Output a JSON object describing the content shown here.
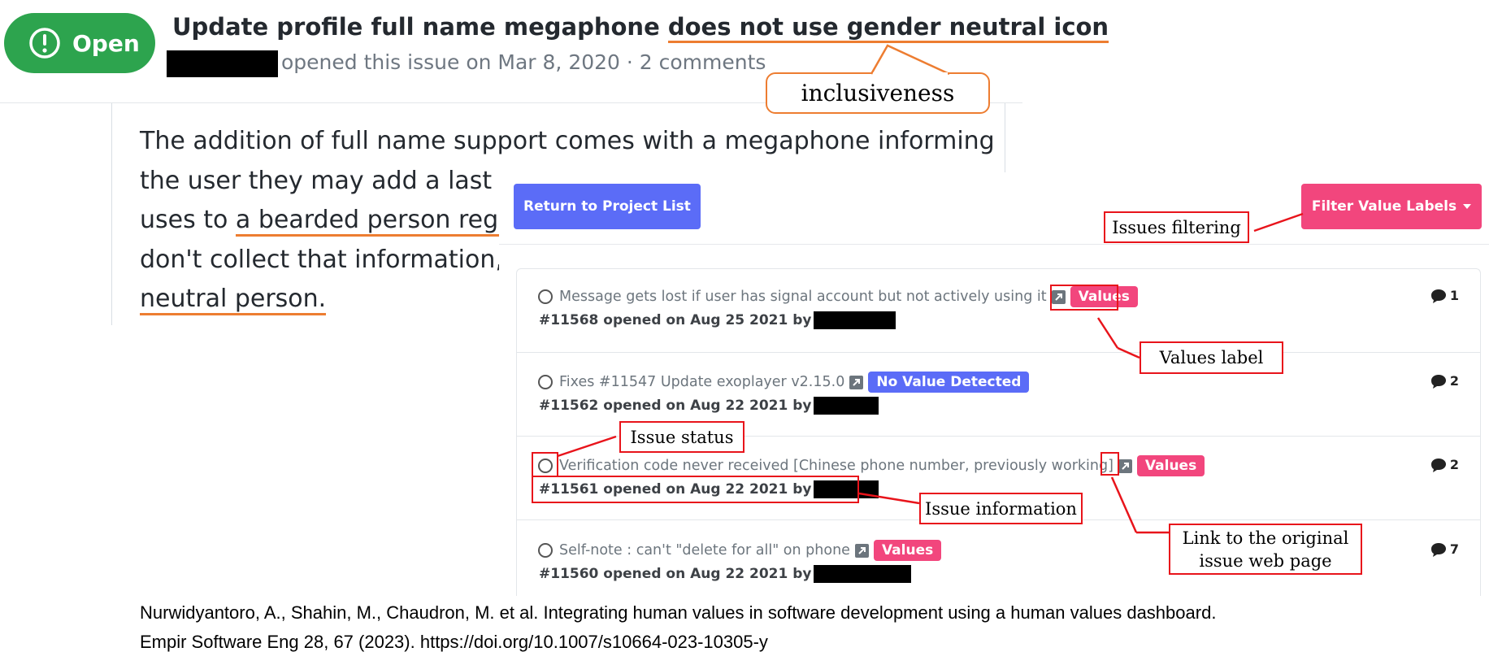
{
  "github_issue": {
    "status_label": "Open",
    "title_plain": "Update profile full name megaphone ",
    "title_highlight": "does not use gender neutral icon",
    "meta": "opened this issue on Mar 8, 2020 · 2 comments",
    "body_lines": [
      {
        "plain": "The addition of full name support comes with a megaphone informing",
        "highlight": ""
      },
      {
        "plain": "the user they may add a last na",
        "highlight": ""
      },
      {
        "plain": "uses to ",
        "highlight": "a bearded person rega"
      },
      {
        "plain": "don't collect that information, ",
        "highlight": ""
      },
      {
        "plain": "",
        "highlight": "neutral person."
      }
    ]
  },
  "dashboard": {
    "return_button": "Return to Project List",
    "filter_button": "Filter Value Labels",
    "issues": [
      {
        "title": "Message gets lost if user has signal account but not actively using it",
        "badge": "Values",
        "badge_type": "values",
        "info": "#11568 opened on Aug 25 2021 by",
        "comments": "1"
      },
      {
        "title": "Fixes #11547 Update exoplayer v2.15.0",
        "badge": "No Value Detected",
        "badge_type": "novalue",
        "info": "#11562 opened on Aug 22 2021 by",
        "comments": "2"
      },
      {
        "title": "Verification code never received [Chinese phone number, previously working]",
        "badge": "Values",
        "badge_type": "values",
        "info": "#11561 opened on Aug 22 2021 by",
        "comments": "2"
      },
      {
        "title": "Self-note : can't \"delete for all\" on phone",
        "badge": "Values",
        "badge_type": "values",
        "info": "#11560 opened on Aug 22 2021 by",
        "comments": "7"
      }
    ]
  },
  "annotations": {
    "inclusiveness": "inclusiveness",
    "issues_filtering": "Issues filtering",
    "values_label": "Values label",
    "issue_status": "Issue status",
    "issue_information": "Issue information",
    "link_original_line1": "Link to the original",
    "link_original_line2": "issue web page"
  },
  "colors": {
    "accent_orange": "#ed7d31",
    "annotation_red": "#e8141b",
    "open_green": "#2da44e",
    "values_pink": "#f2467d",
    "primary_blue": "#5b6cf7"
  },
  "citation": {
    "line1": "Nurwidyantoro, A., Shahin, M., Chaudron, M. et al. Integrating human values in software development using a human values dashboard.",
    "line2": "Empir Software Eng 28, 67 (2023). https://doi.org/10.1007/s10664-023-10305-y"
  }
}
